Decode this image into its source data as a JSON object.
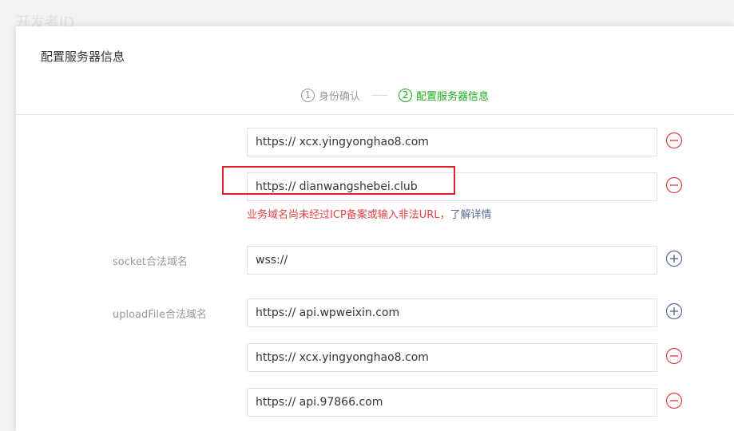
{
  "background": {
    "title": "开发者ID"
  },
  "dialog": {
    "title": "配置服务器信息",
    "steps": [
      {
        "number": "1",
        "label": "身份确认",
        "active": false
      },
      {
        "number": "2",
        "label": "配置服务器信息",
        "active": true
      }
    ]
  },
  "request_domains": {
    "values": [
      "https:// xcx.yingyonghao8.com",
      "https:// dianwangshebei.club"
    ],
    "error": {
      "message": "业务域名尚未经过ICP备案或输入非法URL，",
      "link": "了解详情"
    }
  },
  "socket": {
    "label": "socket合法域名",
    "value": "wss://"
  },
  "upload": {
    "label": "uploadFile合法域名",
    "values": [
      "https:// api.wpweixin.com",
      "https:// xcx.yingyonghao8.com",
      "https:// api.97866.com"
    ]
  },
  "colors": {
    "accent": "#1aad19",
    "error": "#e64340",
    "link": "#576b95",
    "remove_icon": "#e64340",
    "add_icon": "#576b95",
    "highlight": "#e3202a"
  },
  "icons": {
    "remove": "minus-circle-icon",
    "add": "plus-circle-icon"
  }
}
